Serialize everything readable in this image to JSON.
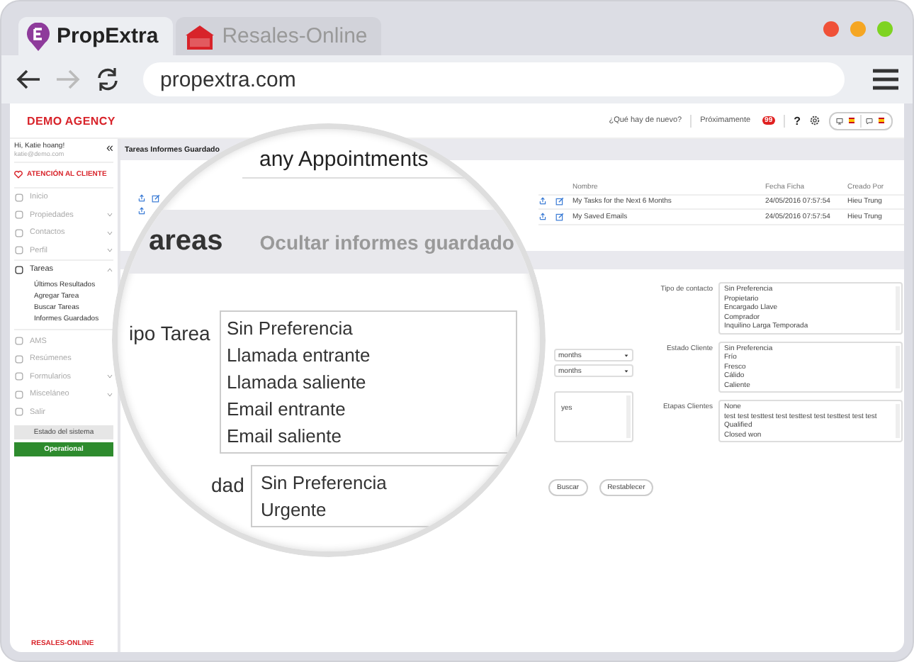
{
  "browser": {
    "tabs": [
      {
        "label": "PropExtra",
        "selected": true
      },
      {
        "label": "Resales-Online",
        "selected": false
      }
    ],
    "url": "propextra.com"
  },
  "header": {
    "logo": "DEMO AGENCY",
    "whats_new": "¿Qué hay de nuevo?",
    "coming_soon": "Próximamente",
    "coming_soon_badge": "99",
    "help": "?"
  },
  "sidebar": {
    "greeting": "Hi, Katie hoang!",
    "email": "katie@demo.com",
    "collapse": "«",
    "support": "ATENCIÓN AL CLIENTE",
    "items": [
      {
        "label": "Inicio",
        "kind": "link"
      },
      {
        "label": "Propiedades",
        "kind": "group",
        "expanded": false
      },
      {
        "label": "Contactos",
        "kind": "group",
        "expanded": false
      },
      {
        "label": "Perfil",
        "kind": "group",
        "expanded": false
      },
      {
        "label": "Tareas",
        "kind": "group",
        "expanded": true,
        "children": [
          {
            "label": "Últimos Resultados"
          },
          {
            "label": "Agregar Tarea"
          },
          {
            "label": "Buscar Tareas"
          },
          {
            "label": "Informes Guardados"
          }
        ]
      },
      {
        "label": "AMS",
        "kind": "link"
      },
      {
        "label": "Resúmenes",
        "kind": "link"
      },
      {
        "label": "Formularios",
        "kind": "group",
        "expanded": false
      },
      {
        "label": "Misceláneo",
        "kind": "group",
        "expanded": false
      },
      {
        "label": "Salir",
        "kind": "link"
      }
    ],
    "system_status_button": "Estado del sistema",
    "status": "Operational",
    "footer_logo": "RESALES-ONLINE"
  },
  "page_title": "Tareas Informes Guardado",
  "saved_reports": {
    "columns": [
      "Nombre",
      "Fecha Ficha",
      "Creado Por"
    ],
    "rows": [
      {
        "name": "My Tasks for the Next 6 Months",
        "date": "24/05/2016 07:57:54",
        "creator": "Hieu Trung"
      },
      {
        "name": "My Saved Emails",
        "date": "24/05/2016 07:57:54",
        "creator": "Hieu Trung"
      }
    ]
  },
  "magnifier": {
    "heading": "any Appointments",
    "section_title": "areas",
    "hide_saved": "Ocultar informes guardado",
    "task_type_label": "ipo Tarea",
    "task_types": [
      "Sin Preferencia",
      "Llamada entrante",
      "Llamada saliente",
      "Email entrante",
      "Email saliente"
    ],
    "priority_label": "dad",
    "priorities": [
      "Sin Preferencia",
      "Urgente"
    ]
  },
  "date_selects": [
    "months",
    "months"
  ],
  "middle_list": [
    "yes"
  ],
  "filters": [
    {
      "label": "Tipo de contacto",
      "options": [
        "Sin Preferencia",
        "Propietario",
        "Encargado Llave",
        "Comprador",
        "Inquilino Larga Temporada"
      ]
    },
    {
      "label": "Estado Cliente",
      "options": [
        "Sin Preferencia",
        "Frío",
        "Fresco",
        "Cálido",
        "Caliente"
      ]
    },
    {
      "label": "Etapas Clientes",
      "options": [
        "None",
        "test test testtest test testtest test testtest test test",
        "Qualified",
        "Closed won"
      ]
    }
  ],
  "buttons": [
    "Buscar",
    "Restablecer"
  ]
}
